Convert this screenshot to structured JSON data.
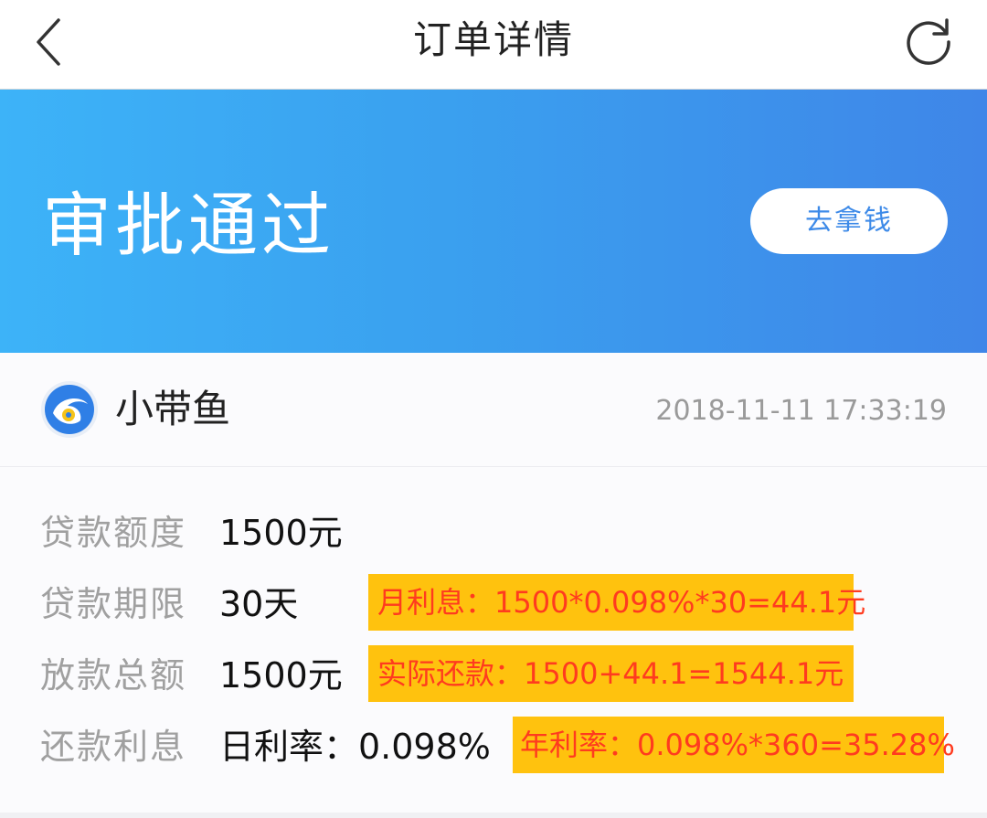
{
  "nav": {
    "title": "订单详情",
    "back_icon": "chevron-left-icon",
    "refresh_icon": "refresh-icon"
  },
  "banner": {
    "status": "审批通过",
    "action_label": "去拿钱",
    "gradient_start": "#3db3f8",
    "gradient_end": "#3f86e8"
  },
  "merchant": {
    "name": "小带鱼",
    "logo_icon": "fish-logo-icon",
    "time": "2018-11-11 17:33:19"
  },
  "details": [
    {
      "label": "贷款额度",
      "value": "1500元"
    },
    {
      "label": "贷款期限",
      "value": "30天"
    },
    {
      "label": "放款总额",
      "value": "1500元"
    },
    {
      "label": "还款利息",
      "value": "日利率：0.098%"
    }
  ],
  "annotations": {
    "monthly_interest": "月利息：1500*0.098%*30=44.1元",
    "actual_repayment": "实际还款：1500+44.1=1544.1元",
    "annual_rate": "年利率：0.098%*360=35.28%",
    "highlight_color": "#ffc20e",
    "text_color": "#ff3b1f"
  }
}
